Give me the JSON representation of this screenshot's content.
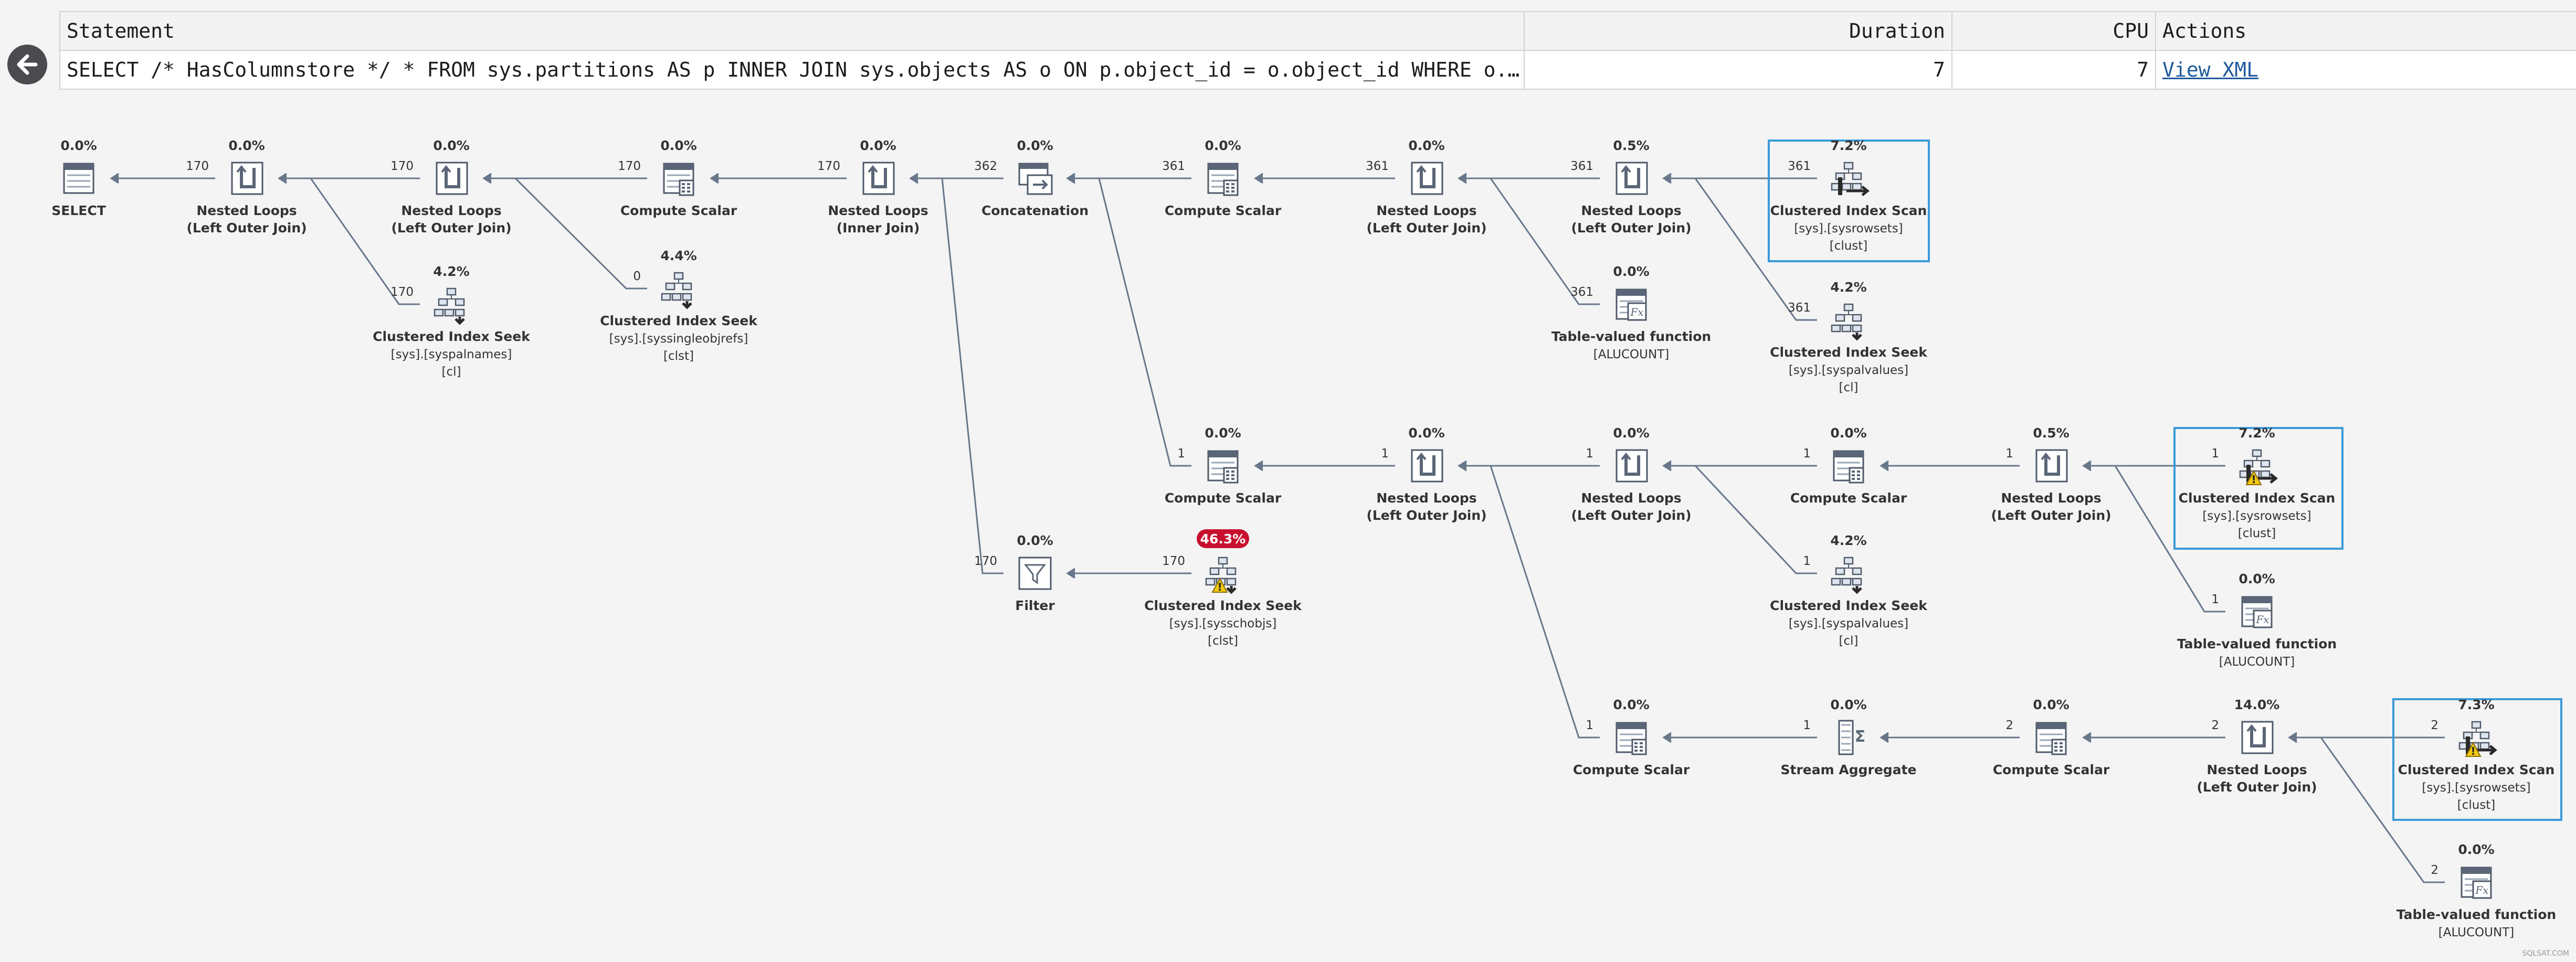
{
  "header": {
    "statement_label": "Statement",
    "duration_label": "Duration",
    "cpu_label": "CPU",
    "actions_label": "Actions",
    "statement_text": "SELECT /* HasColumnstore */ * FROM sys.partitions AS p INNER JOIN sys.objects AS o ON p.object_id = o.object_id WHERE o.…",
    "duration_value": "7",
    "cpu_value": "7",
    "view_xml_label": "View XML"
  },
  "back_button": {
    "icon": "arrow-left-icon"
  },
  "colors": {
    "edge": "#68778a",
    "highlight_box": "#3a9ad9",
    "hot_badge": "#c8102e",
    "warning": "#f2c811"
  },
  "plan": {
    "nodes": [
      {
        "id": "select",
        "pct": "0.0%",
        "label": [
          "SELECT"
        ],
        "icon": "select-icon"
      },
      {
        "id": "nl1",
        "pct": "0.0%",
        "label": [
          "Nested Loops",
          "(Left Outer Join)"
        ],
        "icon": "nested-loops-icon"
      },
      {
        "id": "nl2",
        "pct": "0.0%",
        "label": [
          "Nested Loops",
          "(Left Outer Join)"
        ],
        "icon": "nested-loops-icon"
      },
      {
        "id": "cs1",
        "pct": "0.0%",
        "label": [
          "Compute Scalar"
        ],
        "icon": "compute-scalar-icon"
      },
      {
        "id": "nl3",
        "pct": "0.0%",
        "label": [
          "Nested Loops",
          "(Inner Join)"
        ],
        "icon": "nested-loops-icon"
      },
      {
        "id": "concat",
        "pct": "0.0%",
        "label": [
          "Concatenation"
        ],
        "icon": "concatenation-icon"
      },
      {
        "id": "cs2",
        "pct": "0.0%",
        "label": [
          "Compute Scalar"
        ],
        "icon": "compute-scalar-icon"
      },
      {
        "id": "nl4",
        "pct": "0.0%",
        "label": [
          "Nested Loops",
          "(Left Outer Join)"
        ],
        "icon": "nested-loops-icon"
      },
      {
        "id": "nl5",
        "pct": "0.5%",
        "label": [
          "Nested Loops",
          "(Left Outer Join)"
        ],
        "icon": "nested-loops-icon"
      },
      {
        "id": "cis1",
        "pct": "7.2%",
        "label": [
          "Clustered Index Scan",
          "[sys].[sysrowsets]",
          "[clust]"
        ],
        "icon": "clustered-index-scan-icon",
        "highlight": true
      },
      {
        "id": "seek1",
        "pct": "4.2%",
        "label": [
          "Clustered Index Seek",
          "[sys].[syspalnames]",
          "[cl]"
        ],
        "icon": "clustered-index-seek-icon"
      },
      {
        "id": "seek2",
        "pct": "4.4%",
        "label": [
          "Clustered Index Seek",
          "[sys].[syssingleobjrefs]",
          "[clst]"
        ],
        "icon": "clustered-index-seek-icon"
      },
      {
        "id": "tvf1",
        "pct": "0.0%",
        "label": [
          "Table-valued function",
          "[ALUCOUNT]"
        ],
        "icon": "table-valued-function-icon"
      },
      {
        "id": "seek3",
        "pct": "4.2%",
        "label": [
          "Clustered Index Seek",
          "[sys].[syspalvalues]",
          "[cl]"
        ],
        "icon": "clustered-index-seek-icon"
      },
      {
        "id": "cs3",
        "pct": "0.0%",
        "label": [
          "Compute Scalar"
        ],
        "icon": "compute-scalar-icon"
      },
      {
        "id": "nl6",
        "pct": "0.0%",
        "label": [
          "Nested Loops",
          "(Left Outer Join)"
        ],
        "icon": "nested-loops-icon"
      },
      {
        "id": "nl7",
        "pct": "0.0%",
        "label": [
          "Nested Loops",
          "(Left Outer Join)"
        ],
        "icon": "nested-loops-icon"
      },
      {
        "id": "cs4",
        "pct": "0.0%",
        "label": [
          "Compute Scalar"
        ],
        "icon": "compute-scalar-icon"
      },
      {
        "id": "nl8",
        "pct": "0.5%",
        "label": [
          "Nested Loops",
          "(Left Outer Join)"
        ],
        "icon": "nested-loops-icon"
      },
      {
        "id": "cis2",
        "pct": "7.2%",
        "label": [
          "Clustered Index Scan",
          "[sys].[sysrowsets]",
          "[clust]"
        ],
        "icon": "clustered-index-scan-icon",
        "highlight": true,
        "warning": true
      },
      {
        "id": "filter",
        "pct": "0.0%",
        "label": [
          "Filter"
        ],
        "icon": "filter-icon"
      },
      {
        "id": "seek4",
        "pct": "46.3%",
        "label": [
          "Clustered Index Seek",
          "[sys].[sysschobjs]",
          "[clst]"
        ],
        "icon": "clustered-index-seek-icon",
        "hot": true,
        "warning": true
      },
      {
        "id": "seek5",
        "pct": "4.2%",
        "label": [
          "Clustered Index Seek",
          "[sys].[syspalvalues]",
          "[cl]"
        ],
        "icon": "clustered-index-seek-icon"
      },
      {
        "id": "tvf2",
        "pct": "0.0%",
        "label": [
          "Table-valued function",
          "[ALUCOUNT]"
        ],
        "icon": "table-valued-function-icon"
      },
      {
        "id": "cs5",
        "pct": "0.0%",
        "label": [
          "Compute Scalar"
        ],
        "icon": "compute-scalar-icon"
      },
      {
        "id": "agg",
        "pct": "0.0%",
        "label": [
          "Stream Aggregate"
        ],
        "icon": "stream-aggregate-icon"
      },
      {
        "id": "cs6",
        "pct": "0.0%",
        "label": [
          "Compute Scalar"
        ],
        "icon": "compute-scalar-icon"
      },
      {
        "id": "nl9",
        "pct": "14.0%",
        "label": [
          "Nested Loops",
          "(Left Outer Join)"
        ],
        "icon": "nested-loops-icon"
      },
      {
        "id": "cis3",
        "pct": "7.3%",
        "label": [
          "Clustered Index Scan",
          "[sys].[sysrowsets]",
          "[clust]"
        ],
        "icon": "clustered-index-scan-icon",
        "highlight": true,
        "warning": true
      },
      {
        "id": "tvf3",
        "pct": "0.0%",
        "label": [
          "Table-valued function",
          "[ALUCOUNT]"
        ],
        "icon": "table-valued-function-icon"
      }
    ],
    "edges": [
      {
        "from": "nl1",
        "to": "select",
        "rows": "170"
      },
      {
        "from": "nl2",
        "to": "nl1",
        "rows": "170"
      },
      {
        "from": "seek1",
        "to": "nl1",
        "rows": "170"
      },
      {
        "from": "cs1",
        "to": "nl2",
        "rows": "170"
      },
      {
        "from": "seek2",
        "to": "nl2",
        "rows": "0"
      },
      {
        "from": "nl3",
        "to": "cs1",
        "rows": "170"
      },
      {
        "from": "concat",
        "to": "nl3",
        "rows": "362"
      },
      {
        "from": "filter",
        "to": "nl3",
        "rows": "170"
      },
      {
        "from": "cs2",
        "to": "concat",
        "rows": "361"
      },
      {
        "from": "cs3",
        "to": "concat",
        "rows": "1"
      },
      {
        "from": "nl4",
        "to": "cs2",
        "rows": "361"
      },
      {
        "from": "nl5",
        "to": "nl4",
        "rows": "361"
      },
      {
        "from": "tvf1",
        "to": "nl4",
        "rows": "361"
      },
      {
        "from": "cis1",
        "to": "nl5",
        "rows": "361"
      },
      {
        "from": "seek3",
        "to": "nl5",
        "rows": "361"
      },
      {
        "from": "seek4",
        "to": "filter",
        "rows": "170"
      },
      {
        "from": "nl6",
        "to": "cs3",
        "rows": "1"
      },
      {
        "from": "nl7",
        "to": "nl6",
        "rows": "1"
      },
      {
        "from": "cs5",
        "to": "nl6",
        "rows": "1"
      },
      {
        "from": "cs4",
        "to": "nl7",
        "rows": "1"
      },
      {
        "from": "seek5",
        "to": "nl7",
        "rows": "1"
      },
      {
        "from": "nl8",
        "to": "cs4",
        "rows": "1"
      },
      {
        "from": "cis2",
        "to": "nl8",
        "rows": "1"
      },
      {
        "from": "tvf2",
        "to": "nl8",
        "rows": "1"
      },
      {
        "from": "agg",
        "to": "cs5",
        "rows": "1"
      },
      {
        "from": "cs6",
        "to": "agg",
        "rows": "2"
      },
      {
        "from": "nl9",
        "to": "cs6",
        "rows": "2"
      },
      {
        "from": "cis3",
        "to": "nl9",
        "rows": "2"
      },
      {
        "from": "tvf3",
        "to": "nl9",
        "rows": "2"
      }
    ]
  },
  "watermark": "SQLSAT.COM"
}
